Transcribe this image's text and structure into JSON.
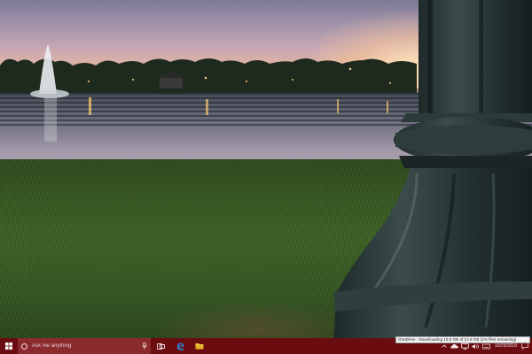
{
  "desktop": {
    "wallpaper": "lake-sunset-fountain-lamp-post"
  },
  "taskbar": {
    "color": "#6b0d10",
    "search": {
      "placeholder": "Ask me anything"
    },
    "pinned_apps": [
      {
        "name": "task-view-icon"
      },
      {
        "name": "edge-icon"
      },
      {
        "name": "file-explorer-icon"
      }
    ],
    "tray": {
      "tooltip": "OneDrive - Downloading 10.5 GB of 12.8 GB (1% files remaining)",
      "clock": {
        "time": "",
        "date": "10/25/2019"
      }
    }
  }
}
